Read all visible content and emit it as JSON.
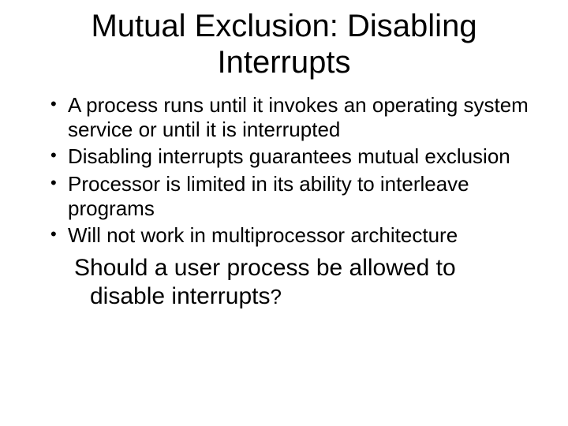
{
  "title": "Mutual Exclusion: Disabling Interrupts",
  "bullets": [
    "A process runs until it invokes an operating system service or until it is interrupted",
    "Disabling interrupts guarantees mutual exclusion",
    "Processor is limited in its ability to interleave programs",
    "Will not work in multiprocessor architecture"
  ],
  "question_main": "Should a user process be allowed to disable interrupts",
  "question_mark": "?"
}
